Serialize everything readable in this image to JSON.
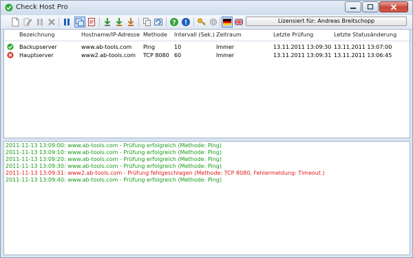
{
  "window": {
    "title": "Check Host Pro",
    "license_text": "Lizensiert für: Andreas Breitschopp"
  },
  "toolbar": {
    "buttons": [
      {
        "name": "new-host",
        "icon": "new-document-icon"
      },
      {
        "name": "edit-host",
        "icon": "edit-icon"
      },
      {
        "name": "pause",
        "icon": "pause-icon"
      },
      {
        "name": "delete-host",
        "icon": "delete-icon"
      },
      {
        "name": "pause-all",
        "icon": "pause-blue-icon"
      },
      {
        "name": "view-list",
        "icon": "window-list-icon"
      },
      {
        "name": "view-log",
        "icon": "log-icon"
      },
      {
        "name": "import",
        "icon": "import-icon"
      },
      {
        "name": "export",
        "icon": "export-icon"
      },
      {
        "name": "export-log",
        "icon": "export-log-icon"
      },
      {
        "name": "copy",
        "icon": "copy-icon"
      },
      {
        "name": "refresh",
        "icon": "refresh-icon"
      },
      {
        "name": "help",
        "icon": "help-icon"
      },
      {
        "name": "info",
        "icon": "info-icon"
      },
      {
        "name": "key",
        "icon": "key-icon"
      },
      {
        "name": "settings",
        "icon": "gear-icon"
      },
      {
        "name": "language-de",
        "icon": "german-flag-icon"
      },
      {
        "name": "language-en",
        "icon": "uk-flag-icon"
      }
    ]
  },
  "table": {
    "columns": [
      "Bezeichnung",
      "Hostname/IP-Adresse",
      "Methode",
      "Intervall (Sek.)",
      "Zeitraum",
      "Letzte Prüfung",
      "Letzte Statusänderung"
    ],
    "rows": [
      {
        "status": "ok",
        "cells": [
          "Backupserver",
          "www.ab-tools.com",
          "Ping",
          "10",
          "Immer",
          "13.11.2011 13:09:30",
          "13.11.2011 13:07:00"
        ]
      },
      {
        "status": "error",
        "cells": [
          "Hauptserver",
          "www2.ab-tools.com",
          "TCP 8080",
          "60",
          "Immer",
          "13.11.2011 13:09:31",
          "13.11.2011 13:06:45"
        ]
      }
    ]
  },
  "colors": {
    "log_success": "#1a9a1a",
    "log_error": "#e01b1b"
  },
  "log": [
    {
      "type": "success",
      "text": "2011-11-13 13:09:00: www.ab-tools.com - Prüfung erfolgreich (Methode: Ping)"
    },
    {
      "type": "success",
      "text": "2011-11-13 13:09:10: www.ab-tools.com - Prüfung erfolgreich (Methode: Ping)"
    },
    {
      "type": "success",
      "text": "2011-11-13 13:09:20: www.ab-tools.com - Prüfung erfolgreich (Methode: Ping)"
    },
    {
      "type": "success",
      "text": "2011-11-13 13:09:30: www.ab-tools.com - Prüfung erfolgreich (Methode: Ping)"
    },
    {
      "type": "error",
      "text": "2011-11-13 13:09:31: www2.ab-tools.com - Prüfung fehlgeschlagen (Methode: TCP 8080, Fehlermeldung: Timeout.)"
    },
    {
      "type": "success",
      "text": "2011-11-13 13:09:40: www.ab-tools.com - Prüfung erfolgreich (Methode: Ping)"
    }
  ]
}
